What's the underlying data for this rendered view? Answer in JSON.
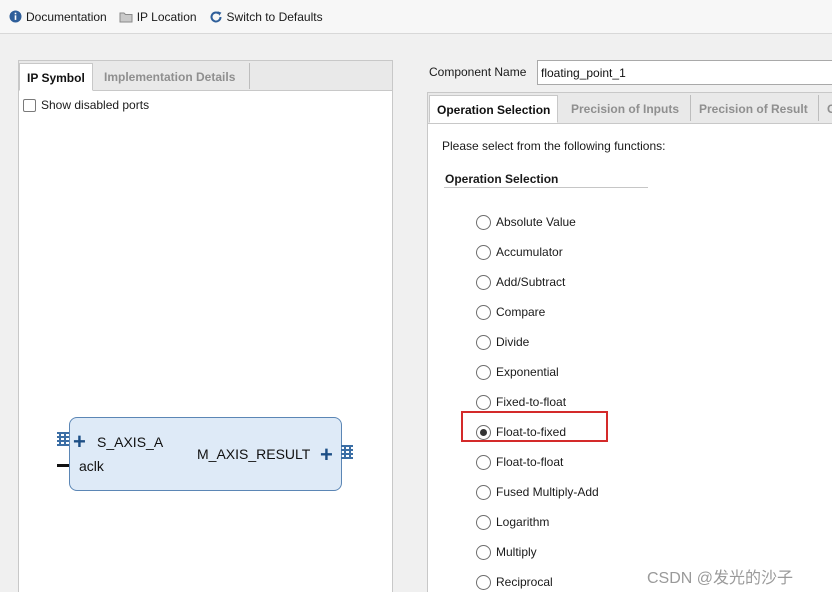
{
  "toolbar": {
    "items": [
      {
        "label": "Documentation",
        "icon": "info-icon"
      },
      {
        "label": "IP Location",
        "icon": "folder-icon"
      },
      {
        "label": "Switch to Defaults",
        "icon": "refresh-icon"
      }
    ]
  },
  "left_panel": {
    "tabs": [
      "IP Symbol",
      "Implementation Details"
    ],
    "show_disabled_ports": "Show disabled ports",
    "ip_symbol": {
      "input_port": "S_AXIS_A",
      "clock_port": "aclk",
      "output_port": "M_AXIS_RESULT"
    }
  },
  "component": {
    "label": "Component Name",
    "value": "floating_point_1"
  },
  "right_panel": {
    "tabs": [
      "Operation Selection",
      "Precision of Inputs",
      "Precision of Result",
      "C"
    ],
    "prompt": "Please select from the following functions:",
    "section_title": "Operation Selection",
    "operations": [
      "Absolute Value",
      "Accumulator",
      "Add/Subtract",
      "Compare",
      "Divide",
      "Exponential",
      "Fixed-to-float",
      "Float-to-fixed",
      "Float-to-float",
      "Fused Multiply-Add",
      "Logarithm",
      "Multiply",
      "Reciprocal"
    ],
    "selected_operation": "Float-to-fixed"
  },
  "colors": {
    "accent_blue": "#1d4f86",
    "highlight_red": "#d42a2a",
    "block_fill": "#deeaf7"
  },
  "watermark": "CSDN @发光的沙子"
}
